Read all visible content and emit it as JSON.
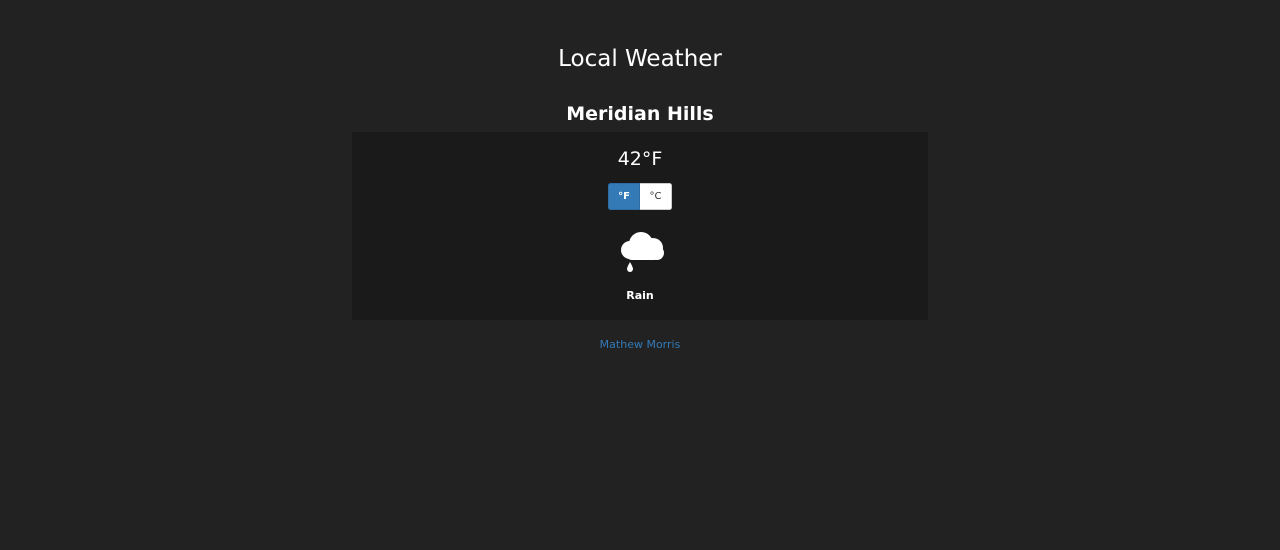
{
  "header": {
    "title": "Local Weather"
  },
  "weather": {
    "location": "Meridian Hills",
    "temperature": "42°F",
    "units": {
      "fahrenheit_label": "°F",
      "celsius_label": "°C",
      "selected": "fahrenheit"
    },
    "icon": "rain-cloud-icon",
    "condition": "Rain"
  },
  "footer": {
    "author_link": "Mathew Morris"
  },
  "colors": {
    "background": "#222222",
    "card_background": "#1a1a1a",
    "accent": "#337ab7",
    "text": "#ffffff"
  }
}
